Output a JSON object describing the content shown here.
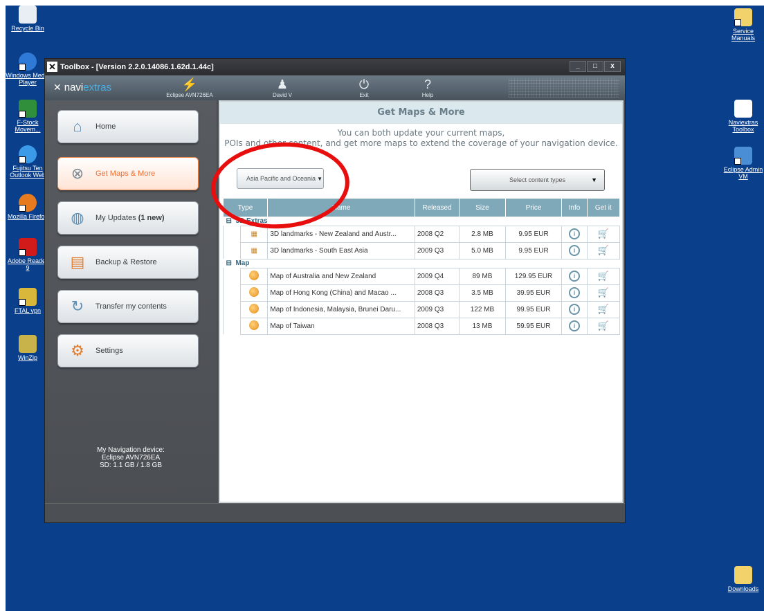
{
  "desktop": {
    "left_icons": [
      {
        "label": "Recycle Bin",
        "icon": "recycle-bin-icon"
      },
      {
        "label": "Windows Media Player",
        "icon": "media-player-icon"
      },
      {
        "label": "F-Stock Movem...",
        "icon": "excel-icon"
      },
      {
        "label": "Fujitsu Ten Outlook Web",
        "icon": "ie-icon"
      },
      {
        "label": "Mozilla Firefox",
        "icon": "firefox-icon"
      },
      {
        "label": "Adobe Reader 9",
        "icon": "adobe-icon"
      },
      {
        "label": "FTAL vpn",
        "icon": "vpn-icon"
      },
      {
        "label": "WinZip",
        "icon": "winzip-icon"
      }
    ],
    "right_icons": [
      {
        "label": "Service Manuals",
        "icon": "folder-icon"
      },
      {
        "label": "Naviextras Toolbox",
        "icon": "naviextras-icon"
      },
      {
        "label": "Eclipse Admin VM",
        "icon": "vm-icon"
      },
      {
        "label": "Downloads",
        "icon": "folder-icon"
      }
    ]
  },
  "window": {
    "title": "Toolbox - [Version 2.2.0.14086.1.62d.1.44c]",
    "controls": [
      "_",
      "□",
      "x"
    ]
  },
  "toolbar": {
    "logo_a": "navi",
    "logo_b": "extras",
    "device_label": "Eclipse AVN726EA",
    "user_label": "David V",
    "exit_label": "Exit",
    "help_label": "Help"
  },
  "sidebar": {
    "items": [
      {
        "label": "Home",
        "icon": "home-icon"
      },
      {
        "label": "Get Maps & More",
        "icon": "compass-icon",
        "active": true
      },
      {
        "label": "My Updates",
        "badge": "(1 new)",
        "icon": "globe-updates-icon"
      },
      {
        "label": "Backup & Restore",
        "icon": "backup-icon"
      },
      {
        "label": "Transfer my contents",
        "icon": "transfer-icon"
      },
      {
        "label": "Settings",
        "icon": "settings-icon"
      }
    ],
    "device_title": "My Navigation device:",
    "device_name": "Eclipse AVN726EA",
    "device_storage": "SD: 1.1 GB / 1.8 GB"
  },
  "content": {
    "title": "Get Maps & More",
    "intro_line1": "You can both update your current maps,",
    "intro_line2": "POIs and other content, and get more maps to extend the coverage of your navigation device.",
    "region_select": "Asia Pacific and Oceania",
    "content_type_select": "Select content types",
    "columns": [
      "Type",
      "Name",
      "Released",
      "Size",
      "Price",
      "Info",
      "Get it"
    ],
    "groups": [
      {
        "name": "3D Extras",
        "rows": [
          {
            "name": "3D landmarks - New Zealand and Austr...",
            "released": "2008 Q2",
            "size": "2.8 MB",
            "price": "9.95 EUR"
          },
          {
            "name": "3D landmarks - South East Asia",
            "released": "2009 Q3",
            "size": "5.0 MB",
            "price": "9.95 EUR"
          }
        ]
      },
      {
        "name": "Map",
        "rows": [
          {
            "name": "Map of Australia and New Zealand",
            "released": "2009 Q4",
            "size": "89 MB",
            "price": "129.95 EUR"
          },
          {
            "name": "Map of Hong Kong (China) and Macao ...",
            "released": "2008 Q3",
            "size": "3.5 MB",
            "price": "39.95 EUR"
          },
          {
            "name": "Map of Indonesia, Malaysia, Brunei Daru...",
            "released": "2009 Q3",
            "size": "122 MB",
            "price": "99.95 EUR"
          },
          {
            "name": "Map of Taiwan",
            "released": "2008 Q3",
            "size": "13 MB",
            "price": "59.95 EUR"
          }
        ]
      }
    ]
  }
}
